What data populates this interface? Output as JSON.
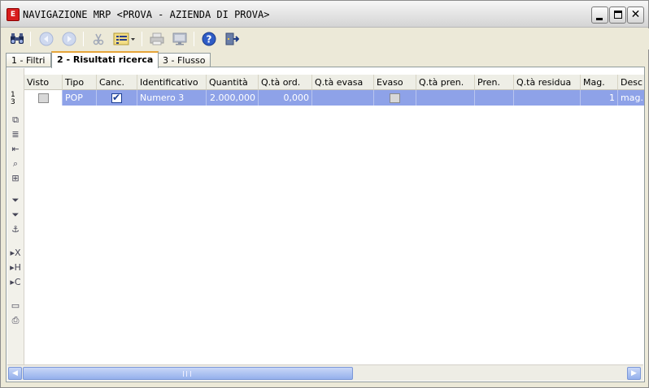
{
  "window": {
    "app_icon_text": "E",
    "title": "NAVIGAZIONE MRP <PROVA - AZIENDA DI PROVA>",
    "controls": {
      "minimize": "minimize",
      "maximize": "maximize",
      "close": "✕"
    }
  },
  "toolbar": {
    "icons": [
      "binoculars-icon",
      "back-icon",
      "forward-icon",
      "cut-icon",
      "list-options-icon",
      "print-icon",
      "monitor-icon",
      "help-icon",
      "exit-icon"
    ]
  },
  "tabs": [
    {
      "label": "1 - Filtri"
    },
    {
      "label": "2 - Risultati ricerca"
    },
    {
      "label": "3 - Flusso"
    }
  ],
  "grid": {
    "columns": [
      "Visto",
      "Tipo",
      "Canc.",
      "Identificativo",
      "Quantità",
      "Q.tà ord.",
      "Q.tà evasa",
      "Evaso",
      "Q.tà pren.",
      "Pren.",
      "Q.tà residua",
      "Mag.",
      "Desc"
    ],
    "rows": [
      {
        "row_number_line1": "1",
        "row_number_line2": "3",
        "visto": false,
        "tipo": "POP",
        "canc": true,
        "identificativo": "Numero 3",
        "quantita": "2.000,000",
        "qta_ord": "0,000",
        "qta_evasa": "",
        "evaso": false,
        "qta_pren": "",
        "pren": "",
        "qta_residua": "",
        "mag": "1",
        "desc": "mag."
      }
    ]
  },
  "scrollbar": {
    "grip_text": "III"
  }
}
